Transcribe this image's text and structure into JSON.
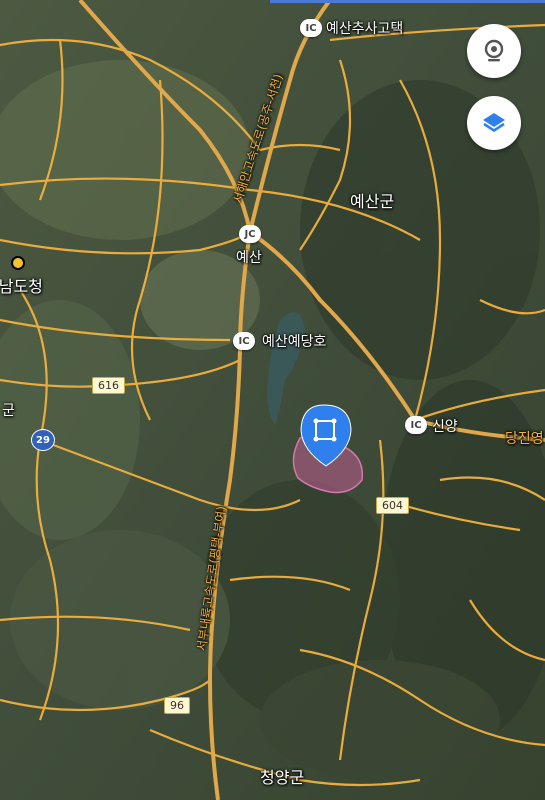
{
  "labels": {
    "yesan_sa_ic": "예산추사고택",
    "yesan_gun": "예산군",
    "yesan": "예산",
    "yedang_lake": "예산예당호",
    "sinyang": "신양",
    "dangjin": "당진영",
    "chungnam_office": "충남도청",
    "gun_left": "군",
    "cheongyang": "청양군",
    "expressway_top": "서해안고속도로(공주-서천)",
    "expressway_bottom": "서부내륙고속도로(평택-부여)"
  },
  "badges": {
    "ic": "IC",
    "jc": "JC",
    "route_616": "616",
    "route_604": "604",
    "route_96": "96",
    "route_29": "29"
  },
  "controls": {
    "location_icon": "location-target-icon",
    "layers_icon": "layers-icon"
  },
  "colors": {
    "road": "#f2b13e",
    "expressway": "#e0a84a",
    "pin": "#2f80ed",
    "region": "#b45a8a"
  }
}
